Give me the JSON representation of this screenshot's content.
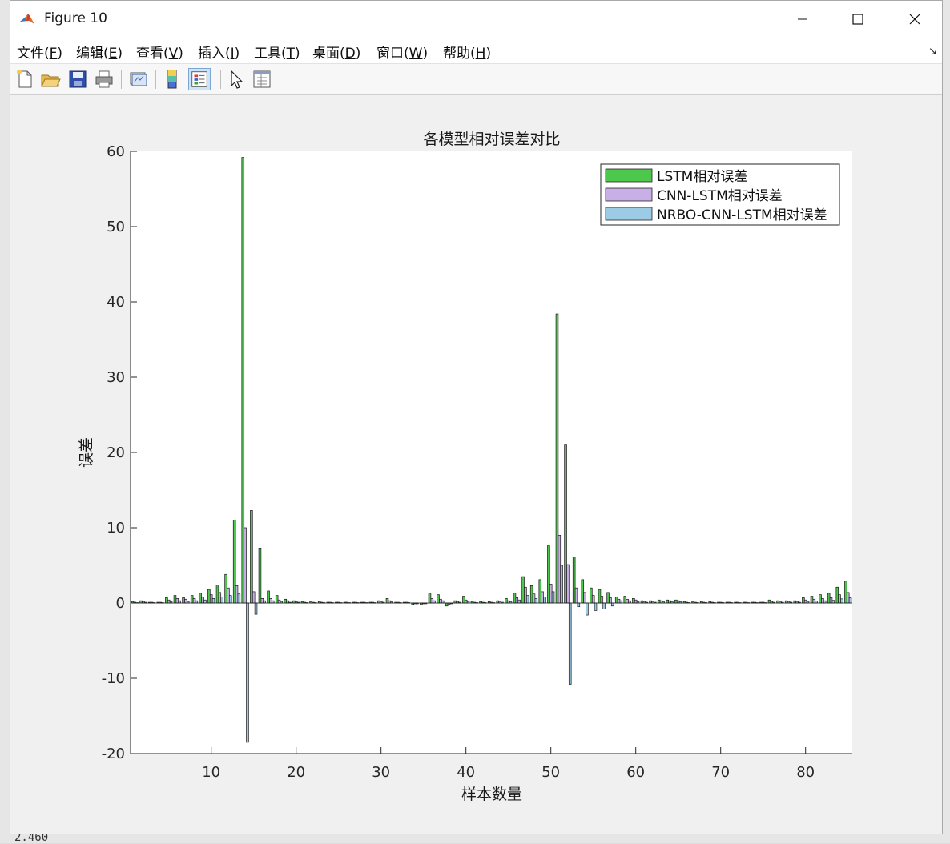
{
  "window": {
    "title": "Figure 10"
  },
  "menu": {
    "items": [
      {
        "main": "文件(",
        "key": "F",
        "end": ")"
      },
      {
        "main": "编辑(",
        "key": "E",
        "end": ")"
      },
      {
        "main": "查看(",
        "key": "V",
        "end": ")"
      },
      {
        "main": "插入(",
        "key": "I",
        "end": ")"
      },
      {
        "main": "工具(",
        "key": "T",
        "end": ")"
      },
      {
        "main": "桌面(",
        "key": "D",
        "end": ")"
      },
      {
        "main": "窗口(",
        "key": "W",
        "end": ")"
      },
      {
        "main": "帮助(",
        "key": "H",
        "end": ")"
      }
    ]
  },
  "toolbar": {
    "icons": [
      "new-file-icon",
      "open-folder-icon",
      "save-icon",
      "print-icon",
      "link-plot-icon",
      "colorbar-icon",
      "legend-icon",
      "select-arrow-icon",
      "property-inspector-icon"
    ]
  },
  "desktop": {
    "fragment_text": "2.460"
  },
  "colors": {
    "lstm": "#4dc84d",
    "cnn_lstm": "#c8b0e6",
    "nrbo": "#9ccbe6",
    "axes_bg": "#ffffff",
    "figure_bg": "#f0f0f0"
  },
  "chart_data": {
    "type": "bar",
    "title": "各模型相对误差对比",
    "xlabel": "样本数量",
    "ylabel": "误差",
    "xlim": [
      0.5,
      85.5
    ],
    "ylim": [
      -20,
      60
    ],
    "xticks": [
      10,
      20,
      30,
      40,
      50,
      60,
      70,
      80
    ],
    "yticks": [
      -20,
      -10,
      0,
      10,
      20,
      30,
      40,
      50,
      60
    ],
    "legend_position": "top-right",
    "grid": false,
    "categories": [
      1,
      2,
      3,
      4,
      5,
      6,
      7,
      8,
      9,
      10,
      11,
      12,
      13,
      14,
      15,
      16,
      17,
      18,
      19,
      20,
      21,
      22,
      23,
      24,
      25,
      26,
      27,
      28,
      29,
      30,
      31,
      32,
      33,
      34,
      35,
      36,
      37,
      38,
      39,
      40,
      41,
      42,
      43,
      44,
      45,
      46,
      47,
      48,
      49,
      50,
      51,
      52,
      53,
      54,
      55,
      56,
      57,
      58,
      59,
      60,
      61,
      62,
      63,
      64,
      65,
      66,
      67,
      68,
      69,
      70,
      71,
      72,
      73,
      74,
      75,
      76,
      77,
      78,
      79,
      80,
      81,
      82,
      83,
      84,
      85
    ],
    "series": [
      {
        "name": "LSTM相对误差",
        "values": [
          0.2,
          0.3,
          0.1,
          0.1,
          0.7,
          1.0,
          0.7,
          1.0,
          1.3,
          1.8,
          2.4,
          3.8,
          11.0,
          59.2,
          12.3,
          7.3,
          1.6,
          1.0,
          0.5,
          0.3,
          0.2,
          0.2,
          0.2,
          0.1,
          0.1,
          0.1,
          0.1,
          0.1,
          0.1,
          0.3,
          0.6,
          0.1,
          0.1,
          -0.2,
          -0.2,
          1.3,
          1.1,
          -0.4,
          0.3,
          0.9,
          0.2,
          0.2,
          0.2,
          0.3,
          0.6,
          1.3,
          3.5,
          2.3,
          3.1,
          7.6,
          38.4,
          21.0,
          6.1,
          3.1,
          2.0,
          1.8,
          1.4,
          0.8,
          0.9,
          0.6,
          0.3,
          0.3,
          0.4,
          0.4,
          0.4,
          0.2,
          0.2,
          0.2,
          0.2,
          0.1,
          0.1,
          0.1,
          0.1,
          0.1,
          0.1,
          0.4,
          0.3,
          0.3,
          0.3,
          0.7,
          0.9,
          1.1,
          1.3,
          2.1,
          2.9
        ]
      },
      {
        "name": "CNN-LSTM相对误差",
        "values": [
          0.1,
          0.2,
          0.1,
          0.1,
          0.4,
          0.6,
          0.5,
          0.6,
          0.8,
          1.1,
          1.4,
          2.0,
          2.3,
          10.0,
          1.5,
          0.6,
          0.6,
          0.4,
          0.3,
          0.2,
          0.1,
          0.1,
          0.1,
          0.1,
          0.1,
          0.1,
          0.1,
          0.1,
          0.1,
          0.2,
          0.3,
          0.1,
          0.1,
          -0.1,
          -0.1,
          0.6,
          0.5,
          -0.2,
          0.2,
          0.4,
          0.1,
          0.1,
          0.1,
          0.2,
          0.3,
          0.7,
          2.1,
          1.2,
          1.5,
          2.5,
          9.0,
          5.1,
          2.0,
          1.4,
          1.0,
          0.9,
          0.7,
          0.5,
          0.5,
          0.4,
          0.2,
          0.2,
          0.3,
          0.3,
          0.3,
          0.1,
          0.1,
          0.1,
          0.1,
          0.1,
          0.1,
          0.1,
          0.1,
          0.1,
          0.1,
          0.2,
          0.2,
          0.2,
          0.2,
          0.4,
          0.5,
          0.6,
          0.7,
          1.1,
          1.4
        ]
      },
      {
        "name": "NRBO-CNN-LSTM相对误差",
        "values": [
          0.05,
          0.1,
          0.05,
          0.05,
          0.2,
          0.3,
          0.2,
          0.3,
          0.4,
          0.6,
          0.8,
          1.0,
          1.2,
          -18.5,
          -1.5,
          0.3,
          0.3,
          0.2,
          0.1,
          0.1,
          0.05,
          0.05,
          0.05,
          0.05,
          0.05,
          0.05,
          0.05,
          0.05,
          0.05,
          0.1,
          0.15,
          0.05,
          0.05,
          -0.1,
          -0.1,
          0.3,
          0.3,
          -0.1,
          0.1,
          0.2,
          0.05,
          0.05,
          0.05,
          0.1,
          0.15,
          0.4,
          1.0,
          0.6,
          0.8,
          1.5,
          5.0,
          -10.8,
          -0.5,
          -1.6,
          -1.0,
          -0.8,
          -0.4,
          0.3,
          0.3,
          0.2,
          0.1,
          0.1,
          0.15,
          0.15,
          0.15,
          0.05,
          0.05,
          0.05,
          0.05,
          0.05,
          0.05,
          0.05,
          0.05,
          0.05,
          0.05,
          0.1,
          0.1,
          0.1,
          0.1,
          0.2,
          0.25,
          0.3,
          0.35,
          0.55,
          0.7
        ]
      }
    ]
  }
}
